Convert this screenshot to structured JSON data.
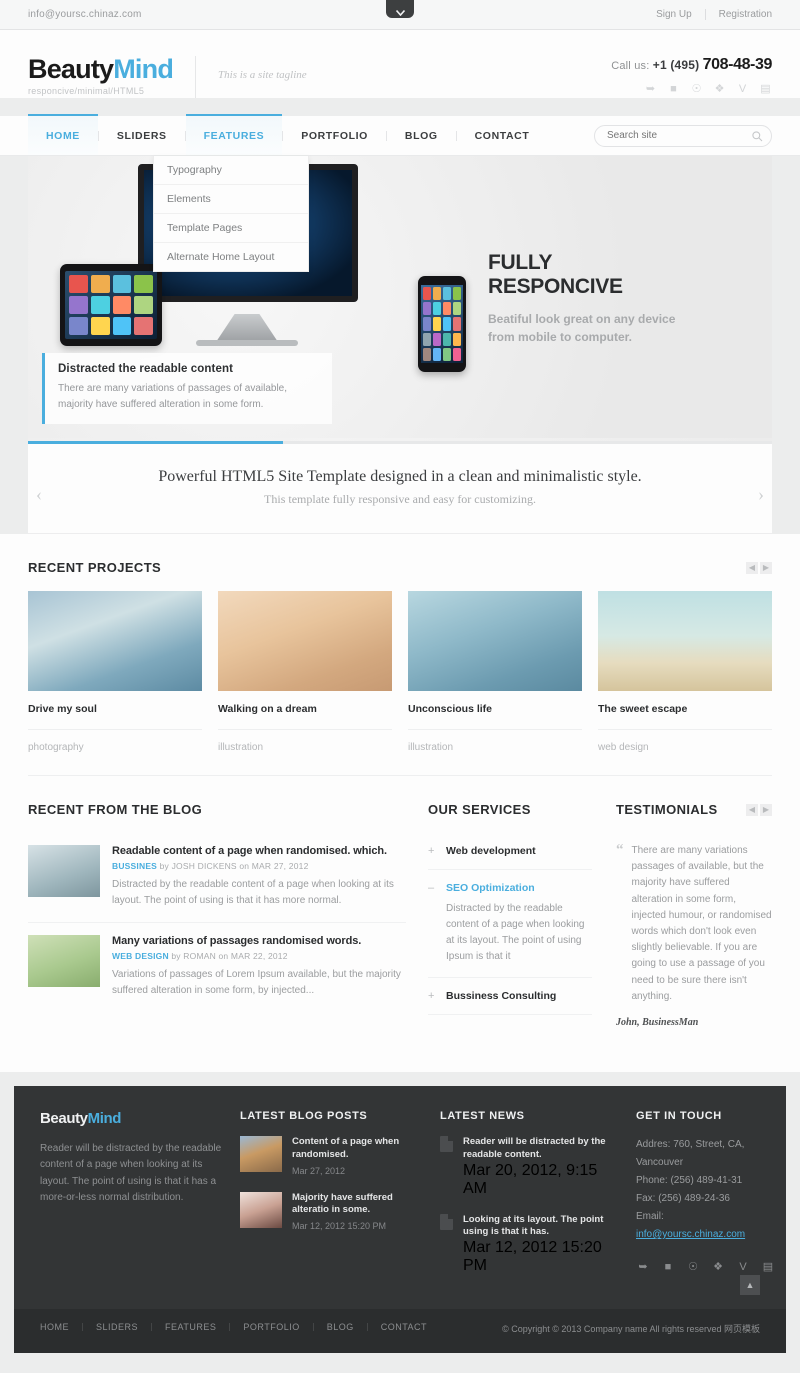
{
  "topbar": {
    "email": "info@yoursc.chinaz.com",
    "links": [
      "Sign Up",
      "Registration"
    ],
    "toggle_icon": "chevron-down-icon"
  },
  "header": {
    "logo_primary": "Beauty",
    "logo_accent": "Mind",
    "logo_sub": "responcive/minimal/HTML5",
    "tagline": "This is a site tagline",
    "call_prefix": "Call us:",
    "call_code": "+1 (495)",
    "call_number": "708-48-39",
    "social_icons": [
      "twitter-icon",
      "facebook-icon",
      "skype-icon",
      "flickr-icon",
      "vimeo-icon",
      "youtube-icon"
    ]
  },
  "nav": {
    "items": [
      {
        "label": "HOME",
        "state": "active"
      },
      {
        "label": "SLIDERS",
        "state": ""
      },
      {
        "label": "FEATURES",
        "state": "open"
      },
      {
        "label": "PORTFOLIO",
        "state": ""
      },
      {
        "label": "BLOG",
        "state": ""
      },
      {
        "label": "CONTACT",
        "state": ""
      }
    ],
    "dropdown": [
      "Typography",
      "Elements",
      "Template Pages",
      "Alternate Home Layout"
    ],
    "search_placeholder": "Search site",
    "search_value": "",
    "search_icon": "search-icon"
  },
  "slider": {
    "title_line1": "FULLY",
    "title_line2": "RESPONCIVE",
    "subtitle_line1": "Beatiful look great on any device",
    "subtitle_line2": "from mobile to computer.",
    "caption_title": "Distracted the readable content",
    "caption_text": "There are many variations of passages of available, majority have suffered alteration in some form.",
    "accent_color": "#4aaede"
  },
  "band": {
    "headline": "Powerful HTML5 Site Template designed in a clean and minimalistic style.",
    "subline": "This template fully responsive and easy for customizing.",
    "prev_icon": "chevron-left-icon",
    "next_icon": "chevron-right-icon"
  },
  "projects": {
    "heading": "RECENT PROJECTS",
    "items": [
      {
        "title": "Drive my soul",
        "category": "photography"
      },
      {
        "title": "Walking on a dream",
        "category": "illustration"
      },
      {
        "title": "Unconscious life",
        "category": "illustration"
      },
      {
        "title": "The sweet escape",
        "category": "web design"
      }
    ]
  },
  "blog": {
    "heading": "RECENT FROM THE BLOG",
    "posts": [
      {
        "title": "Readable content of a page when randomised. which.",
        "category": "BUSSINES",
        "by": "by",
        "author": "JOSH DICKENS",
        "on": "on",
        "date": "MAR 27, 2012",
        "excerpt": "Distracted by the readable content of a page when looking at its layout. The point of using is that it has more normal."
      },
      {
        "title": "Many variations of passages randomised words.",
        "category": "WEB DESIGN",
        "by": "by",
        "author": "ROMAN",
        "on": "on",
        "date": "MAR 22, 2012",
        "excerpt": "Variations of passages of Lorem Ipsum available, but the majority suffered alteration in some form, by injected..."
      }
    ]
  },
  "services": {
    "heading": "OUR SERVICES",
    "items": [
      {
        "sign": "+",
        "title": "Web development",
        "body": "",
        "open": false
      },
      {
        "sign": "–",
        "title": "SEO Optimization",
        "body": "Distracted by the readable content of a page when looking at its layout. The point of using Ipsum is that it",
        "open": true
      },
      {
        "sign": "+",
        "title": "Bussiness Consulting",
        "body": "",
        "open": false
      }
    ]
  },
  "testimonials": {
    "heading": "TESTIMONIALS",
    "quote_mark": "“",
    "text": "There are many variations passages of available, but the majority have suffered alteration in some form, injected humour, or randomised words which don't look even slightly believable. If you are going to use a passage of you need to be sure there isn't anything.",
    "author": "John, BusinessMan"
  },
  "footer": {
    "logo_primary": "Beauty",
    "logo_accent": "Mind",
    "about": "Reader will be distracted by the readable content of a page when looking at its layout. The point of using is that it has a more-or-less normal distribution.",
    "blog_heading": "LATEST BLOG POSTS",
    "blog_posts": [
      {
        "title": "Content of a page when randomised.",
        "date": "Mar 27, 2012"
      },
      {
        "title": "Majority have suffered alteratio in some.",
        "date": "Mar 12, 2012 15:20 PM"
      }
    ],
    "news_heading": "LATEST NEWS",
    "news": [
      {
        "title": "Reader will be distracted by the readable content.",
        "date": "Mar 20, 2012, 9:15 AM"
      },
      {
        "title": "Looking at its layout. The point using is that it has.",
        "date": "Mar 12, 2012 15:20 PM"
      }
    ],
    "contact_heading": "GET IN TOUCH",
    "address": "Addres: 760, Street, CA, Vancouver",
    "phone": "Phone: (256) 489-41-31",
    "fax": "Fax: (256) 489-24-36",
    "email_label": "Email:",
    "email": "info@yoursc.chinaz.com",
    "social_icons": [
      "twitter-icon",
      "facebook-icon",
      "skype-icon",
      "flickr-icon",
      "vimeo-icon",
      "youtube-icon"
    ],
    "to_top_icon": "chevron-up-icon"
  },
  "bottombar": {
    "links": [
      "HOME",
      "SLIDERS",
      "FEATURES",
      "PORTFOLIO",
      "BLOG",
      "CONTACT"
    ],
    "copyright": "© Copyright © 2013 Company name All rights reserved 网页模板"
  }
}
